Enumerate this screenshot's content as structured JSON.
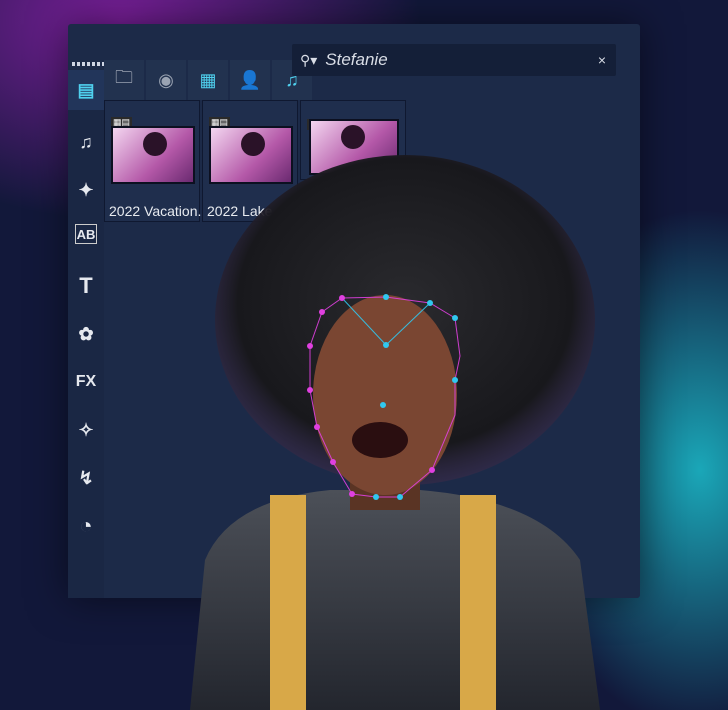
{
  "search": {
    "value": "Stefanie",
    "clear": "×",
    "icon": "search-icon"
  },
  "sidebar": {
    "items": [
      {
        "icon": "media-library-icon",
        "glyph": "▤"
      },
      {
        "icon": "audio-icon",
        "glyph": "♫"
      },
      {
        "icon": "magic-movie-icon",
        "glyph": "✦"
      },
      {
        "icon": "transition-icon",
        "glyph": "AB"
      },
      {
        "icon": "title-icon",
        "glyph": "T"
      },
      {
        "icon": "overlay-icon",
        "glyph": "✿"
      },
      {
        "icon": "fx-icon",
        "glyph": "FX"
      },
      {
        "icon": "magic-wand-icon",
        "glyph": "✧"
      },
      {
        "icon": "motion-path-icon",
        "glyph": "↯"
      },
      {
        "icon": "speed-icon",
        "glyph": "◔"
      }
    ]
  },
  "toolbar": [
    {
      "icon": "import-folder-icon",
      "glyph": "🗀"
    },
    {
      "icon": "aperture-icon",
      "glyph": "◉"
    },
    {
      "icon": "film-icon",
      "glyph": "▦"
    },
    {
      "icon": "person-icon",
      "glyph": "👤"
    },
    {
      "icon": "music-icon",
      "glyph": "♫"
    }
  ],
  "thumbnails": [
    {
      "label": "2022 Vacation..."
    },
    {
      "label": "2022 Lake.."
    },
    {
      "label": ""
    }
  ],
  "colors": {
    "accent": "#4fd0ee",
    "mesh_pink": "#e040e0",
    "mesh_cyan": "#30c8f0"
  }
}
